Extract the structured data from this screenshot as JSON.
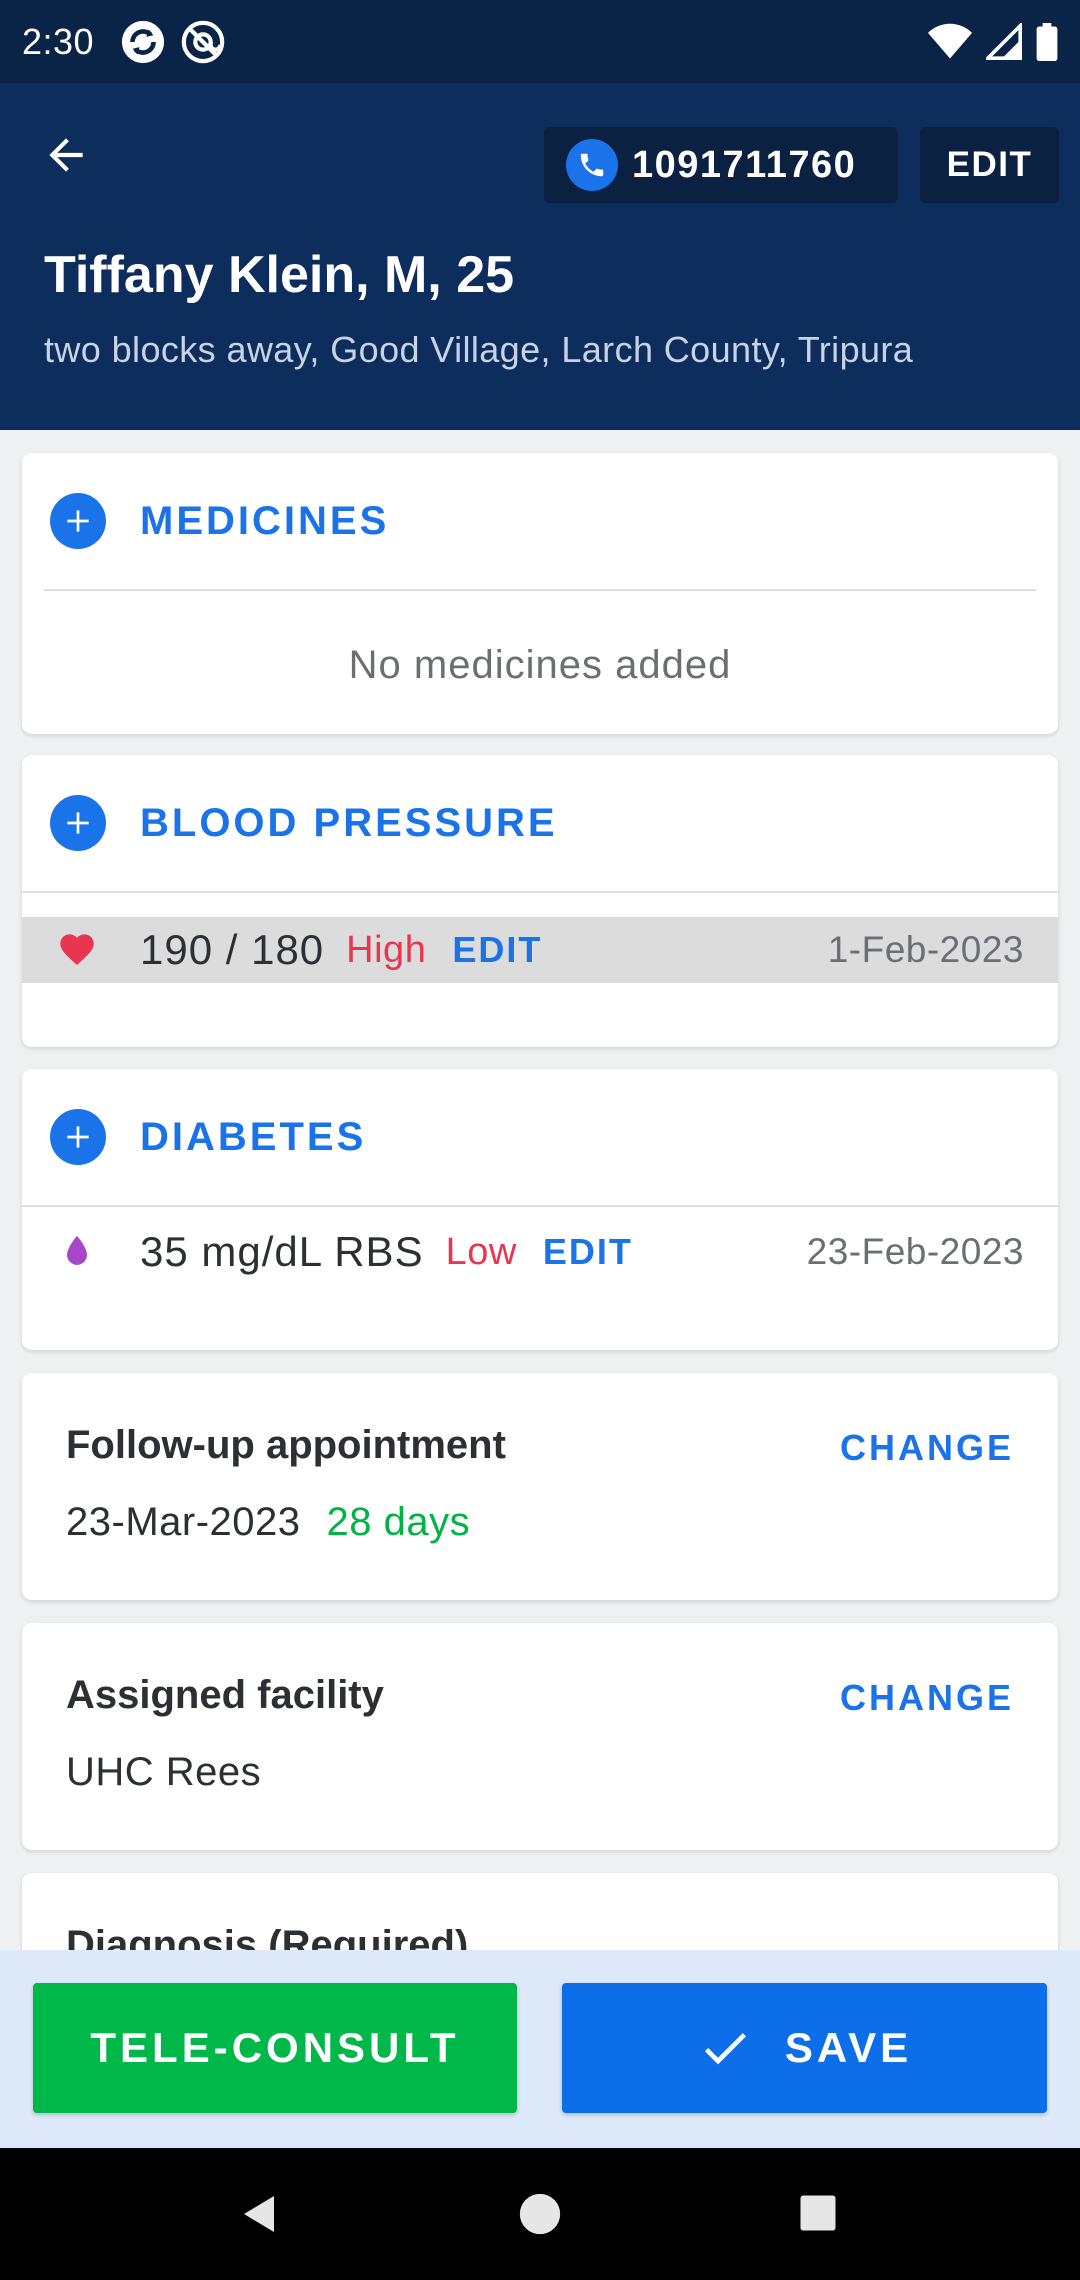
{
  "status_bar": {
    "time": "2:30",
    "icons": [
      "sync-app-icon",
      "at-sign-app-icon",
      "wifi-icon",
      "cell-signal-icon",
      "battery-icon"
    ]
  },
  "header": {
    "phone_number": "1091711760",
    "edit_label": "EDIT",
    "patient_name": "Tiffany Klein, M, 25",
    "patient_address": "two blocks away, Good Village, Larch County, Tripura"
  },
  "medicines": {
    "title": "MEDICINES",
    "empty_text": "No medicines added"
  },
  "blood_pressure": {
    "title": "BLOOD PRESSURE",
    "reading": {
      "value": "190 / 180",
      "status": "High",
      "edit_label": "EDIT",
      "date": "1-Feb-2023"
    }
  },
  "diabetes": {
    "title": "DIABETES",
    "reading": {
      "value": "35 mg/dL RBS",
      "status": "Low",
      "edit_label": "EDIT",
      "date": "23-Feb-2023"
    }
  },
  "follow_up": {
    "label": "Follow-up appointment",
    "change_label": "CHANGE",
    "date": "23-Mar-2023",
    "days": "28 days"
  },
  "facility": {
    "label": "Assigned facility",
    "change_label": "CHANGE",
    "value": "UHC Rees"
  },
  "diagnosis": {
    "label": "Diagnosis (Required)"
  },
  "actions": {
    "tele_consult_label": "TELE-CONSULT",
    "save_label": "SAVE"
  },
  "colors": {
    "header_bg": "#0d2d5c",
    "accent_blue": "#1a73e8",
    "alert_red": "#e83550",
    "success_green": "#00b344",
    "diabetes_purple": "#a845c9"
  }
}
